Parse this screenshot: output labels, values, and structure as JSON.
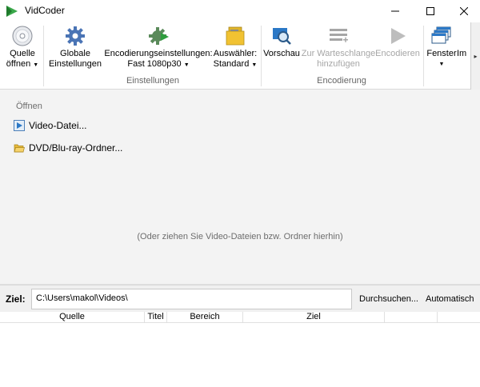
{
  "window": {
    "title": "VidCoder",
    "minimize_icon": "minimize-icon",
    "maximize_icon": "maximize-icon",
    "close_icon": "close-icon"
  },
  "ribbon": {
    "source": {
      "line1": "Quelle",
      "line2": "öffnen",
      "icon": "disc-icon"
    },
    "global_settings": {
      "line1": "Globale",
      "line2": "Einstellungen",
      "icon": "gear-icon"
    },
    "encoding_settings": {
      "line1": "Encodierungseinstellungen:",
      "line2": "Fast 1080p30",
      "icon": "gear-play-icon"
    },
    "picker": {
      "line1": "Auswähler:",
      "line2": "Standard",
      "icon": "folder-picker-icon"
    },
    "settings_group_label": "Einstellungen",
    "preview": {
      "label": "Vorschau",
      "icon": "preview-icon"
    },
    "add_to_queue": {
      "line1": "Zur Warteschlange",
      "line2": "hinzufügen",
      "icon": "queue-add-icon"
    },
    "encode": {
      "label": "Encodieren",
      "icon": "play-icon"
    },
    "encoding_group_label": "Encodierung",
    "windows": {
      "label": "Fenster",
      "icon": "windows-icon"
    },
    "overflow_label": "Im",
    "scroll_right": "▸"
  },
  "open_panel": {
    "heading": "Öffnen",
    "video_file": "Video-Datei...",
    "disc_folder": "DVD/Blu-ray-Ordner...",
    "drop_hint": "(Oder ziehen Sie Video-Dateien bzw. Ordner hierhin)"
  },
  "destination": {
    "label": "Ziel:",
    "path": "C:\\Users\\makol\\Videos\\",
    "browse": "Durchsuchen...",
    "auto": "Automatisch"
  },
  "queue_table": {
    "columns": [
      "Quelle",
      "Titel",
      "Bereich",
      "Ziel",
      "",
      ""
    ]
  },
  "colors": {
    "accent_green": "#2e9e3e",
    "accent_blue": "#2b78c6",
    "disabled_gray": "#a6a6a6"
  }
}
